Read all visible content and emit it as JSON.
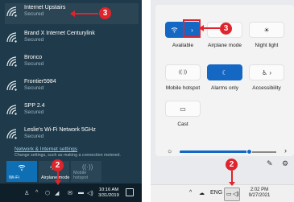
{
  "left": {
    "networks": [
      {
        "ssid": "Internet Upstairs",
        "status": "Secured"
      },
      {
        "ssid": "Brand X Internet Centurylink",
        "status": "Secured"
      },
      {
        "ssid": "Bronco",
        "status": "Secured"
      },
      {
        "ssid": "Frontier5984",
        "status": "Secured"
      },
      {
        "ssid": "SPP 2.4",
        "status": "Secured"
      },
      {
        "ssid": "Leslie's Wi-Fi Network 5GHz",
        "status": "Secured"
      }
    ],
    "settings_link": "Network & Internet settings",
    "settings_desc": "Change settings, such as making a connection metered.",
    "quick_actions": {
      "wifi": "Wi-Fi",
      "airplane": "Airplane mode",
      "hotspot_line1": "Mobile",
      "hotspot_line2": "hotspot"
    },
    "taskbar": {
      "time": "10:16 AM",
      "date": "3/31/2019"
    },
    "badge_top": "3",
    "badge_bottom": "2"
  },
  "right": {
    "tiles": {
      "airplane": "Airplane mode",
      "night_light": "Night light",
      "mobile_hotspot": "Mobile hotspot",
      "alarms": "Alarms only",
      "accessibility": "Accessibility",
      "cast": "Cast",
      "available": "Available"
    },
    "taskbar": {
      "lang": "ENG",
      "time": "2:02 PM",
      "date": "9/27/2021"
    },
    "badge_top": "3",
    "badge_bottom": "2"
  },
  "colors": {
    "annotation": "#e0242c",
    "win10_bg": "#1f3a4a",
    "win11_accent": "#1567c4"
  }
}
